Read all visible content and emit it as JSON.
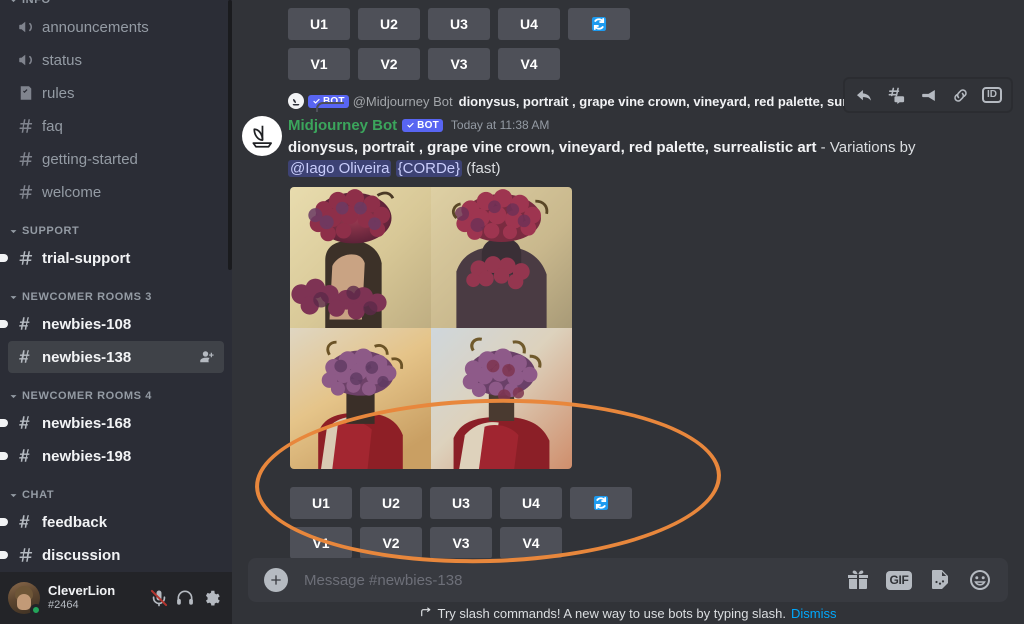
{
  "colors": {
    "sidebar_bg": "#2b2d36",
    "chat_bg": "#313338",
    "accent_blurple": "#5865f2",
    "bot_name_green": "#3ba55c",
    "refresh_blue": "#1d9bf0",
    "annotation_orange": "#e8873c",
    "link_blue": "#00a8fc",
    "online_green": "#23a55a"
  },
  "sidebar": {
    "groups": [
      {
        "label": "INFO",
        "clipped": true,
        "channels": [
          {
            "name": "announcements",
            "icon": "announcement-icon",
            "state": "read"
          },
          {
            "name": "status",
            "icon": "announcement-icon",
            "state": "read"
          },
          {
            "name": "rules",
            "icon": "rules-icon",
            "state": "read"
          },
          {
            "name": "faq",
            "icon": "hash-icon",
            "state": "read"
          },
          {
            "name": "getting-started",
            "icon": "hash-icon",
            "state": "read"
          },
          {
            "name": "welcome",
            "icon": "hash-icon",
            "state": "read"
          }
        ]
      },
      {
        "label": "SUPPORT",
        "clipped": false,
        "channels": [
          {
            "name": "trial-support",
            "icon": "hash-icon",
            "state": "unread"
          }
        ]
      },
      {
        "label": "NEWCOMER ROOMS 3",
        "clipped": false,
        "channels": [
          {
            "name": "newbies-108",
            "icon": "thread-hash-icon",
            "state": "unread"
          },
          {
            "name": "newbies-138",
            "icon": "thread-hash-icon",
            "state": "active",
            "action_icon": "add-member-icon"
          }
        ]
      },
      {
        "label": "NEWCOMER ROOMS 4",
        "clipped": false,
        "channels": [
          {
            "name": "newbies-168",
            "icon": "thread-hash-icon",
            "state": "unread"
          },
          {
            "name": "newbies-198",
            "icon": "thread-hash-icon",
            "state": "unread"
          }
        ]
      },
      {
        "label": "CHAT",
        "clipped": false,
        "channels": [
          {
            "name": "feedback",
            "icon": "thread-hash-icon",
            "state": "unread"
          },
          {
            "name": "discussion",
            "icon": "hash-icon",
            "state": "unread"
          }
        ]
      }
    ]
  },
  "user_panel": {
    "name": "CleverLion",
    "tag": "#2464",
    "status": "online",
    "buttons": [
      {
        "name": "mute-microphone-button",
        "label": "microphone-muted-icon",
        "muted": true
      },
      {
        "name": "deafen-button",
        "label": "headphones-icon",
        "muted": false
      },
      {
        "name": "user-settings-button",
        "label": "gear-icon",
        "muted": false
      }
    ]
  },
  "previous_message_buttons": {
    "upscale_row": [
      "U1",
      "U2",
      "U3",
      "U4"
    ],
    "variation_row": [
      "V1",
      "V2",
      "V3",
      "V4"
    ],
    "refresh_label": "reroll-icon"
  },
  "message": {
    "reply_reference": {
      "bot_badge": "BOT",
      "author": "@Midjourney Bot",
      "text": "dionysus, portrait , grape vine crown, vineyard, red palette, surrealistic art"
    },
    "author": "Midjourney Bot",
    "bot_badge": "BOT",
    "timestamp": "Today at 11:38 AM",
    "prompt": "dionysus, portrait , grape vine crown, vineyard, red palette, surrealistic art",
    "separator": " - ",
    "action_text": "Variations by ",
    "mention_user": "@Iago Oliveira",
    "mention_code": "{CORDe}",
    "speed": " (fast)",
    "grid_alt": "2x2 grid of AI generated surrealist Dionysus portraits with grape cluster heads",
    "upscale_row": [
      "U1",
      "U2",
      "U3",
      "U4"
    ],
    "variation_row": [
      "V1",
      "V2",
      "V3",
      "V4"
    ],
    "refresh_label": "reroll-icon"
  },
  "hover_toolbar": {
    "buttons": [
      {
        "name": "reply-button",
        "icon": "reply-arrow-icon"
      },
      {
        "name": "create-thread-button",
        "icon": "thread-hash-icon"
      },
      {
        "name": "mark-unread-button",
        "icon": "mark-unread-icon"
      },
      {
        "name": "copy-link-button",
        "icon": "link-icon"
      },
      {
        "name": "copy-id-button",
        "icon": "id-icon",
        "text": "ID"
      }
    ]
  },
  "composer": {
    "placeholder": "Message #newbies-138",
    "value": "",
    "plus_label": "add-attachment-icon",
    "actions": [
      {
        "name": "gift-button",
        "icon": "gift-icon"
      },
      {
        "name": "gif-button",
        "icon": "gif-icon",
        "text": "GIF"
      },
      {
        "name": "sticker-button",
        "icon": "sticker-icon"
      },
      {
        "name": "emoji-button",
        "icon": "emoji-icon"
      }
    ]
  },
  "slash_hint": {
    "text": "Try slash commands! A new way to use bots by typing slash.",
    "dismiss": "Dismiss"
  },
  "annotation": {
    "shape": "ellipse",
    "color": "#e8873c",
    "highlights": "midjourney upscale and variation button rows"
  }
}
